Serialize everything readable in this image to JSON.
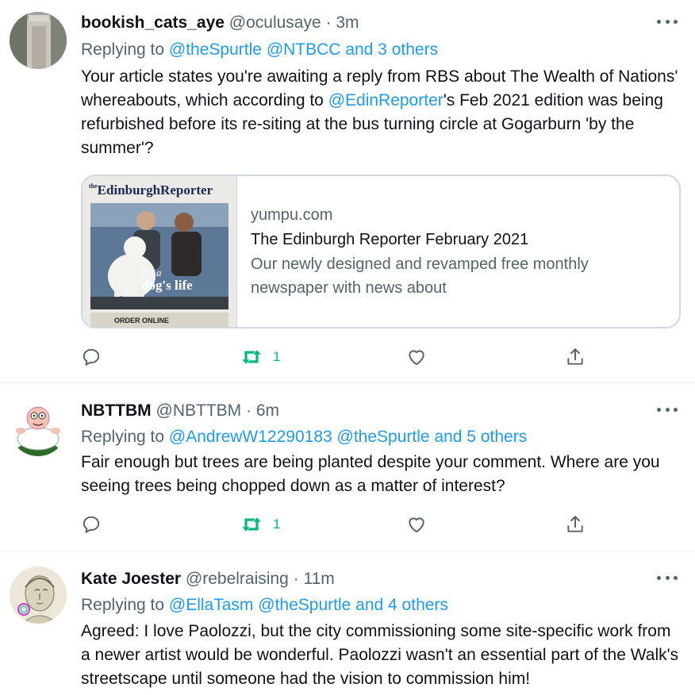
{
  "tweets": [
    {
      "name": "bookish_cats_aye",
      "handle": "@oculusaye",
      "separator": "·",
      "time": "3m",
      "replying_label": "Replying to",
      "replying_to": [
        "@theSpurtle",
        "@NTBCC",
        "and 3 others"
      ],
      "text_parts": [
        "Your article states you're awaiting a reply from RBS about The Wealth of Nations' whereabouts, which according to ",
        "@EdinReporter",
        "'s Feb 2021 edition was being refurbished before its re-siting at the bus turning circle at Gogarburn 'by the summer'?"
      ],
      "card": {
        "masthead": "EdinburghReporter",
        "masthead_small": "the",
        "cover_caption_1": "It's a",
        "cover_caption_2": "dog's life",
        "cover_footer": "ORDER ONLINE",
        "domain": "yumpu.com",
        "title": "The Edinburgh Reporter February 2021",
        "description": "Our newly designed and revamped free monthly newspaper with news about"
      },
      "retweets": "1"
    },
    {
      "name": "NBTTBM",
      "handle": "@NBTTBM",
      "separator": "·",
      "time": "6m",
      "replying_label": "Replying to",
      "replying_to": [
        "@AndrewW12290183",
        "@theSpurtle",
        "and 5 others"
      ],
      "text": "Fair enough but trees are being planted despite your comment. Where are you seeing trees being chopped down as a matter of interest?",
      "retweets": "1"
    },
    {
      "name": "Kate Joester",
      "handle": "@rebelraising",
      "separator": "·",
      "time": "11m",
      "replying_label": "Replying to",
      "replying_to": [
        "@EllaTasm",
        "@theSpurtle",
        "and 4 others"
      ],
      "text": "Agreed: I love Paolozzi, but the city commissioning some site-specific work from a newer artist would be wonderful. Paolozzi wasn't an essential part of the Walk's streetscape until someone had the vision to commission him!"
    }
  ],
  "icons": [
    "reply-icon",
    "retweet-icon",
    "like-icon",
    "share-icon",
    "more-icon"
  ],
  "colors": {
    "link": "#1d9bf0",
    "retweet": "#00ba7c",
    "secondary": "#536471",
    "text": "#0f1419"
  }
}
